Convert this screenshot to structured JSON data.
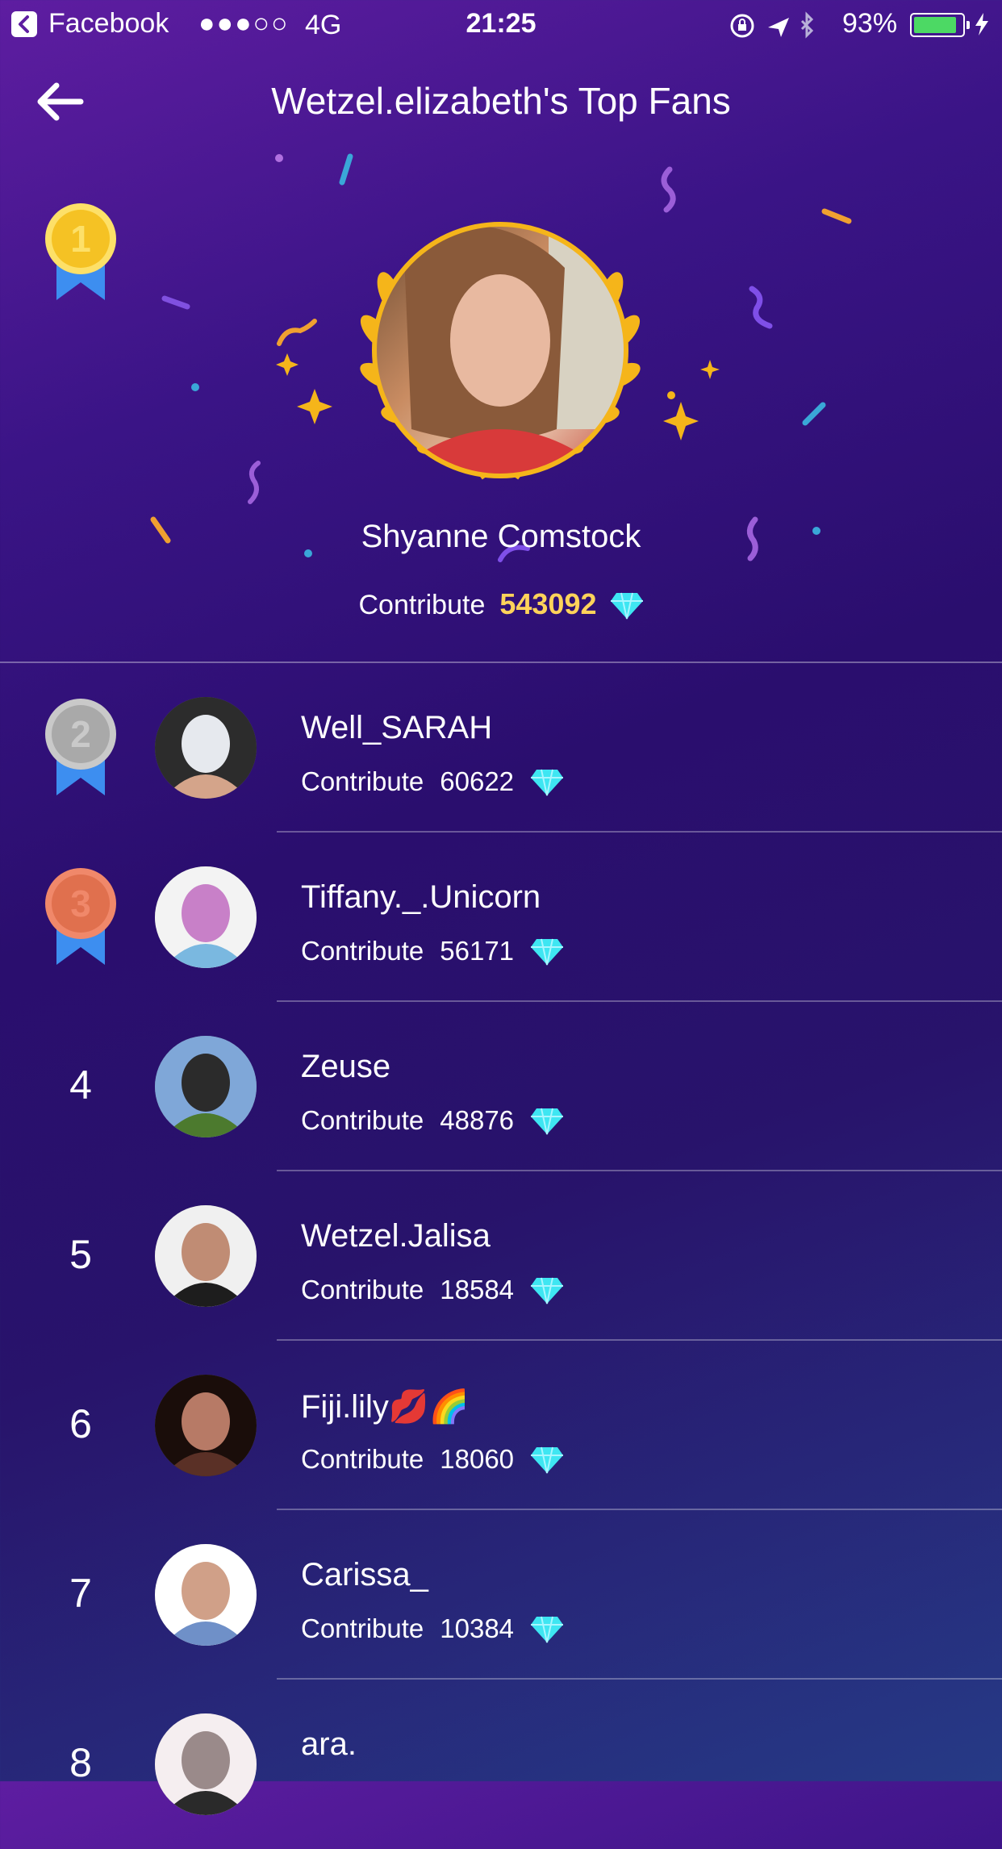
{
  "status_bar": {
    "app_name": "Facebook",
    "signal": "●●●○○",
    "network": "4G",
    "time": "21:25",
    "battery": "93%",
    "battery_level": 0.93
  },
  "header": {
    "title": "Wetzel.elizabeth's Top Fans"
  },
  "top_fan": {
    "rank": "1",
    "name": "Shyanne Comstock",
    "contribute_label": "Contribute",
    "contribute_value": "543092"
  },
  "fans": [
    {
      "rank": "2",
      "name": "Well_SARAH",
      "contribute_label": "Contribute",
      "contribute_value": "60622",
      "medal": "silver"
    },
    {
      "rank": "3",
      "name": "Tiffany._.Unicorn",
      "contribute_label": "Contribute",
      "contribute_value": "56171",
      "medal": "bronze"
    },
    {
      "rank": "4",
      "name": "Zeuse",
      "contribute_label": "Contribute",
      "contribute_value": "48876"
    },
    {
      "rank": "5",
      "name": "Wetzel.Jalisa",
      "contribute_label": "Contribute",
      "contribute_value": "18584"
    },
    {
      "rank": "6",
      "name": "Fiji.lily💋🌈",
      "contribute_label": "Contribute",
      "contribute_value": "18060"
    },
    {
      "rank": "7",
      "name": "Carissa_",
      "contribute_label": "Contribute",
      "contribute_value": "10384"
    },
    {
      "rank": "8",
      "name": "ara."
    }
  ],
  "colors": {
    "gold": "#f5b51a",
    "silver": "#c9c9c9",
    "bronze": "#f0886a",
    "diamond": "#3ee6f2",
    "ribbon": "#3d8ef0",
    "contribute_highlight": "#ffd35a"
  },
  "icons": {
    "back": "arrow-left-icon",
    "diamond": "diamond-icon",
    "medal": "medal-ribbon-icon",
    "laurel": "laurel-wreath-icon"
  }
}
